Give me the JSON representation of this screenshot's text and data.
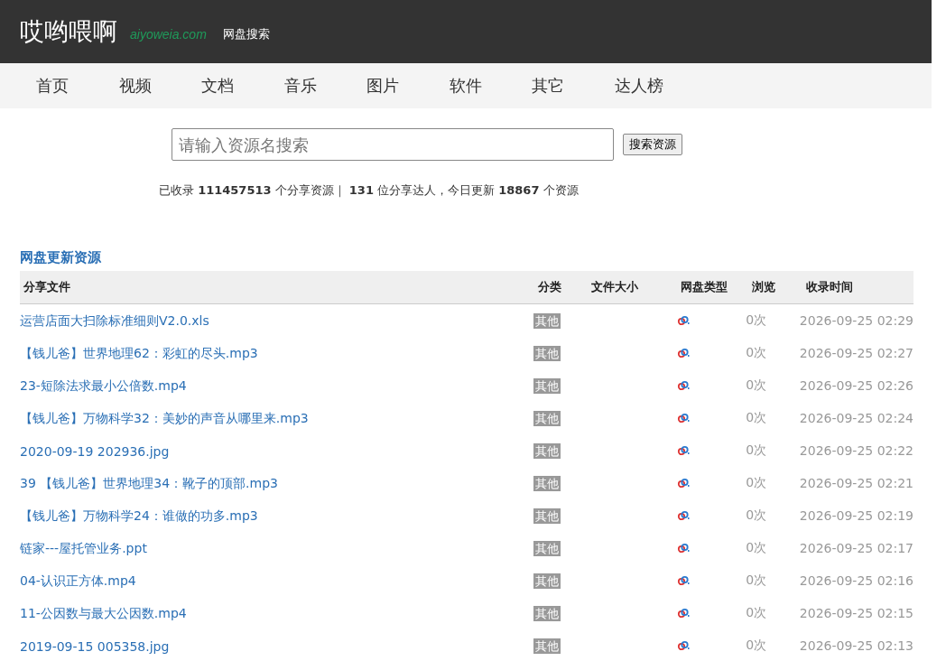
{
  "header": {
    "logo": "哎哟喂啊",
    "domain": "aiyoweia.com",
    "subtitle": "网盘搜索"
  },
  "nav": [
    {
      "label": "首页"
    },
    {
      "label": "视频"
    },
    {
      "label": "文档"
    },
    {
      "label": "音乐"
    },
    {
      "label": "图片"
    },
    {
      "label": "软件"
    },
    {
      "label": "其它"
    },
    {
      "label": "达人榜"
    }
  ],
  "search": {
    "placeholder": "请输入资源名搜索",
    "button": "搜索资源"
  },
  "stats": "已收录 **111457513** 个分享资源｜ **131** 位分享达人，今日更新 **18867** 个资源",
  "section_title": "网盘更新资源",
  "table": {
    "columns": [
      "分享文件",
      "分类",
      "文件大小",
      "网盘类型",
      "浏览",
      "收录时间"
    ],
    "rows": [
      {
        "file": "运营店面大扫除标准细则V2.0.xls",
        "category": "其他",
        "views": "0次",
        "time": "2026-09-25 02:29"
      },
      {
        "file": "【钱儿爸】世界地理62：彩虹的尽头.mp3",
        "category": "其他",
        "views": "0次",
        "time": "2026-09-25 02:27"
      },
      {
        "file": "23-短除法求最小公倍数.mp4",
        "category": "其他",
        "views": "0次",
        "time": "2026-09-25 02:26"
      },
      {
        "file": "【钱儿爸】万物科学32：美妙的声音从哪里来.mp3",
        "category": "其他",
        "views": "0次",
        "time": "2026-09-25 02:24"
      },
      {
        "file": "2020-09-19 202936.jpg",
        "category": "其他",
        "views": "0次",
        "time": "2026-09-25 02:22"
      },
      {
        "file": "39 【钱儿爸】世界地理34：靴子的顶部.mp3",
        "category": "其他",
        "views": "0次",
        "time": "2026-09-25 02:21"
      },
      {
        "file": "【钱儿爸】万物科学24：谁做的功多.mp3",
        "category": "其他",
        "views": "0次",
        "time": "2026-09-25 02:19"
      },
      {
        "file": "链家---屋托管业务.ppt",
        "category": "其他",
        "views": "0次",
        "time": "2026-09-25 02:17"
      },
      {
        "file": "04-认识正方体.mp4",
        "category": "其他",
        "views": "0次",
        "time": "2026-09-25 02:16"
      },
      {
        "file": "11-公因数与最大公因数.mp4",
        "category": "其他",
        "views": "0次",
        "time": "2026-09-25 02:15"
      },
      {
        "file": "2019-09-15 005358.jpg",
        "category": "其他",
        "views": "0次",
        "time": "2026-09-25 02:13"
      }
    ]
  }
}
